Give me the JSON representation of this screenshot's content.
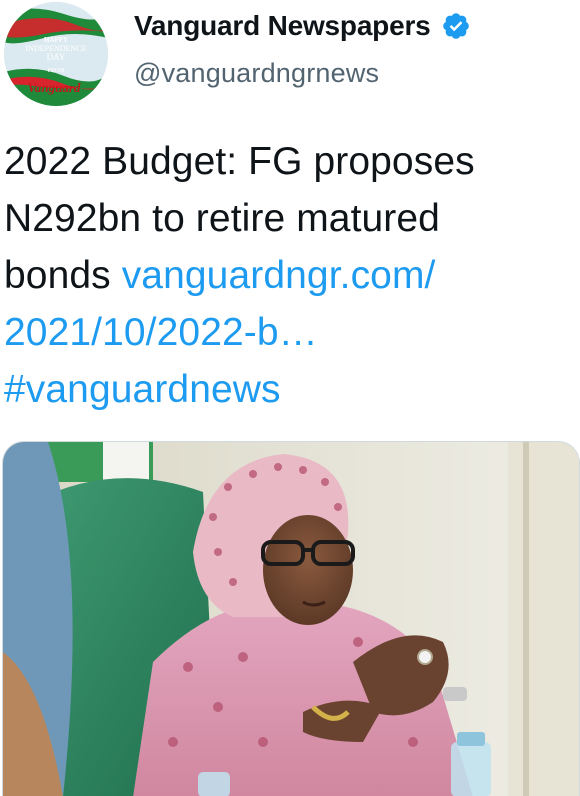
{
  "account": {
    "display_name": "Vanguard Newspapers",
    "handle": "@vanguardngrnews",
    "verified": true,
    "avatar_icon": "independence-day-avatar",
    "avatar_text": [
      "HAPPY",
      "INDEPENDENCE",
      "DAY",
      "FROM",
      "Vanguard"
    ]
  },
  "tweet": {
    "line1": "2022 Budget: FG proposes",
    "line2": "N292bn to retire matured",
    "line3_text": "bonds ",
    "link_part1": "vanguardngr.com/",
    "link_part2": "2021/10/2022-b…",
    "hashtag": "#vanguardnews"
  },
  "media": {
    "type": "photo",
    "icon": "tweet-photo"
  },
  "colors": {
    "link": "#1d9bf0",
    "text": "#0f1419",
    "secondary": "#536471",
    "verified": "#1d9bf0"
  }
}
